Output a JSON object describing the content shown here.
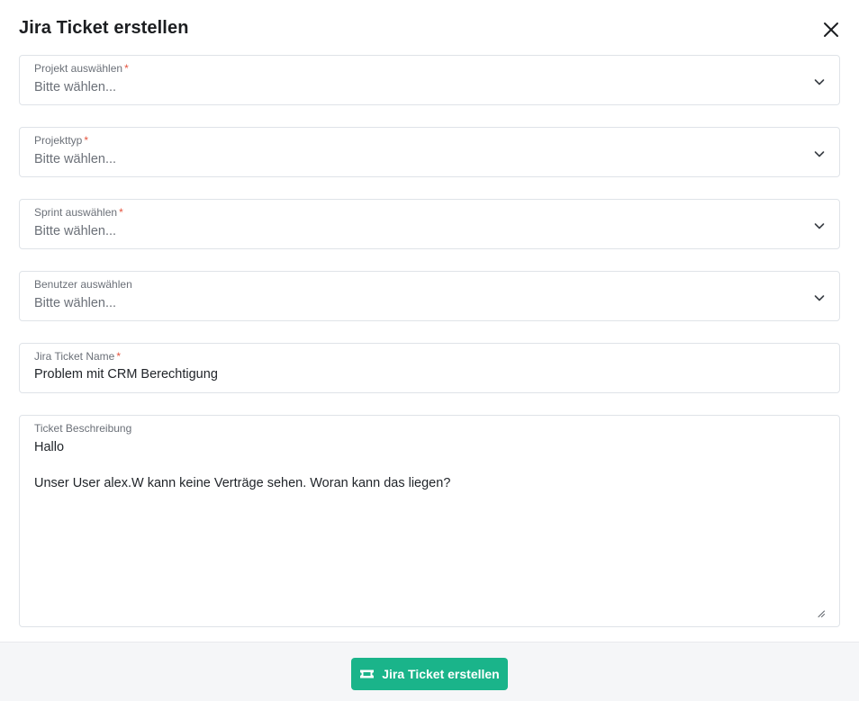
{
  "dialog": {
    "title": "Jira Ticket erstellen"
  },
  "fields": {
    "project": {
      "label": "Projekt auswählen",
      "required_mark": "*",
      "value": "Bitte wählen..."
    },
    "project_type": {
      "label": "Projekttyp",
      "required_mark": "*",
      "value": "Bitte wählen..."
    },
    "sprint": {
      "label": "Sprint auswählen",
      "required_mark": "*",
      "value": "Bitte wählen..."
    },
    "user": {
      "label": "Benutzer auswählen",
      "value": "Bitte wählen..."
    },
    "ticket_name": {
      "label": "Jira Ticket Name",
      "required_mark": "*",
      "value": "Problem mit CRM Berechtigung"
    },
    "description": {
      "label": "Ticket Beschreibung",
      "value": "Hallo\n\nUnser User alex.W kann keine Verträge sehen. Woran kann das liegen?"
    }
  },
  "footer": {
    "submit_label": "Jira Ticket erstellen"
  },
  "icons": {
    "close": "close-icon",
    "chevron": "chevron-down-icon",
    "ticket": "ticket-icon"
  },
  "colors": {
    "primary": "#1ab48a",
    "required": "#e5533d"
  }
}
